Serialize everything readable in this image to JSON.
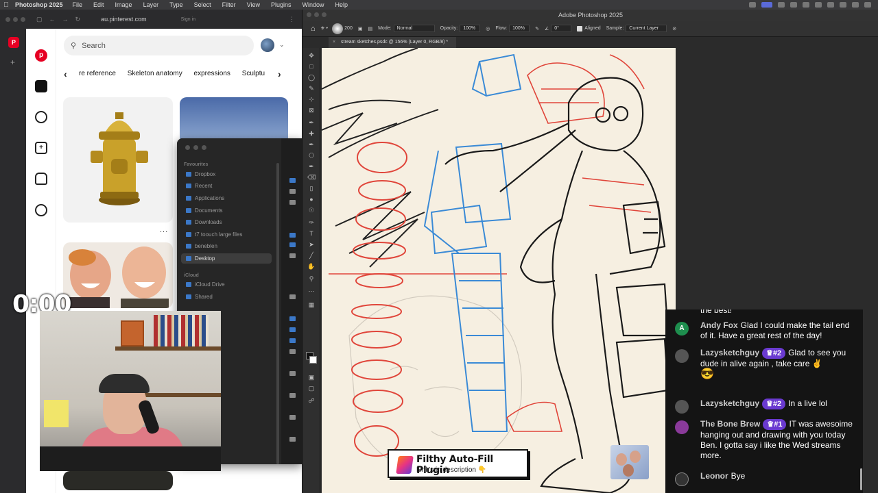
{
  "menubar": {
    "app_name": "Photoshop 2025",
    "items": [
      "File",
      "Edit",
      "Image",
      "Layer",
      "Type",
      "Select",
      "Filter",
      "View",
      "Plugins",
      "Window",
      "Help"
    ]
  },
  "browser": {
    "url": "au.pinterest.com",
    "signin": "Sign in",
    "search_placeholder": "Search",
    "categories": [
      "re reference",
      "Skeleton anatomy",
      "expressions",
      "Sculptu"
    ],
    "more_dots": "..."
  },
  "finder": {
    "favourites_label": "Favourites",
    "favourites": [
      "Dropbox",
      "Recent",
      "Applications",
      "Documents",
      "Downloads",
      "t7 toouch large files",
      "beneblen",
      "Desktop"
    ],
    "selected": "Desktop",
    "icloud_label": "iCloud",
    "icloud": [
      "iCloud Drive",
      "Shared"
    ]
  },
  "stream": {
    "timer": "0:00"
  },
  "photoshop": {
    "window_title": "Adobe Photoshop 2025",
    "tab_title": "stream sketches.psdc @ 156% (Layer 0, RGB/8) *",
    "options": {
      "brush_size": "200",
      "mode_label": "Mode:",
      "mode_value": "Normal",
      "opacity_label": "Opacity:",
      "opacity_value": "100%",
      "flow_label": "Flow:",
      "flow_value": "100%",
      "angle_value": "0°",
      "aligned_label": "Aligned",
      "sample_label": "Sample:",
      "sample_value": "Current Layer"
    }
  },
  "chat": {
    "cut_text": "the best!",
    "messages": [
      {
        "user": "Andy Fox",
        "badge": "",
        "text": "Glad I could make the tail end of it. Have a great rest of the day!",
        "avatar": "A",
        "avatar_color": "#1e8e4e"
      },
      {
        "user": "Lazysketchguy",
        "badge": "♛#2",
        "text": "Glad to see you dude in alive again , take care ✌️",
        "emoji": "😎",
        "avatar": "",
        "avatar_color": "#555"
      },
      {
        "user": "Lazysketchguy",
        "badge": "♛#2",
        "text": "In a live lol",
        "avatar": "",
        "avatar_color": "#555"
      },
      {
        "user": "The Bone Brew",
        "badge": "♛#1",
        "text": "IT was awesoime hanging out and drawing with you today Ben. I gotta say i like the Wed streams more.",
        "avatar": "",
        "avatar_color": "#8a3a9a"
      },
      {
        "user": "Leonor",
        "badge": "",
        "text": "Bye",
        "avatar": "",
        "avatar_color": "#333"
      }
    ]
  },
  "plugin_banner": {
    "title": "Filthy Auto-Fill Plugin",
    "subtitle": "Link's in description 👇"
  },
  "colors": {
    "pinterest_red": "#e60023",
    "sketch_red": "#e0453a",
    "sketch_blue": "#3a8ad6",
    "canvas_bg": "#f6efe1",
    "badge_purple": "#6a3ad0"
  }
}
